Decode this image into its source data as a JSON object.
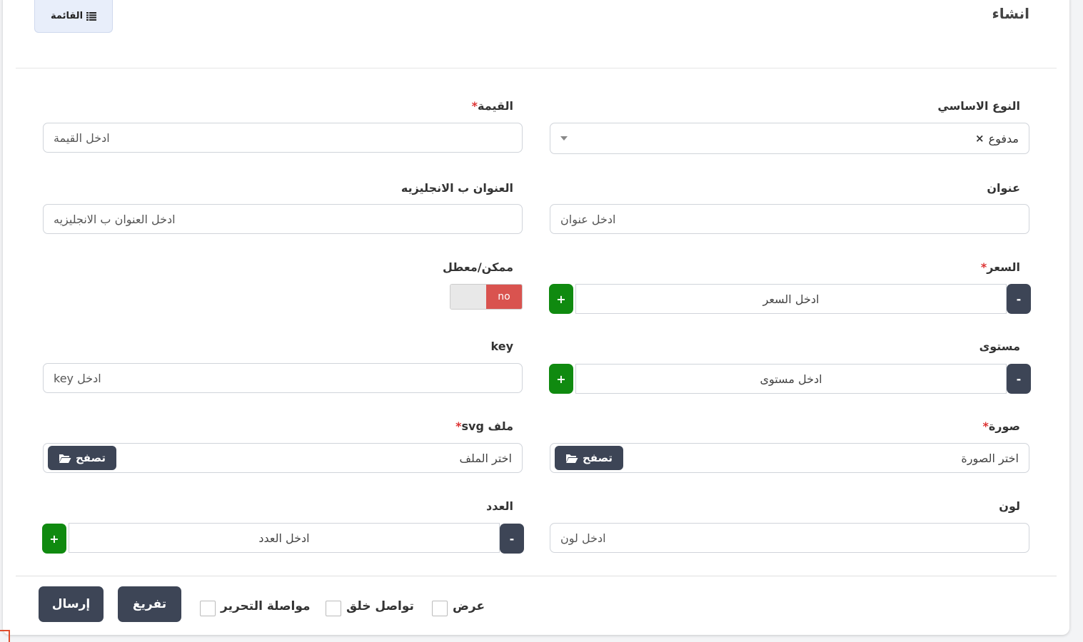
{
  "header": {
    "title": "انشاء",
    "list_button": "القائمة"
  },
  "form": {
    "base_type": {
      "label": "النوع الاساسي",
      "selected": "مدفوع",
      "clear_icon": "×"
    },
    "value": {
      "label": "القيمة",
      "required_mark": "*",
      "placeholder": "ادخل القيمة"
    },
    "title": {
      "label": "عنوان",
      "placeholder": "ادخل عنوان"
    },
    "title_en": {
      "label": "العنوان ب الانجليزيه",
      "placeholder": "ادخل العنوان ب الانجليزيه"
    },
    "price": {
      "label": "السعر",
      "required_mark": "*",
      "placeholder": "ادخل السعر",
      "minus": "-",
      "plus": "+"
    },
    "enabled": {
      "label": "ممكن/معطل",
      "state": "no"
    },
    "level": {
      "label": "مستوى",
      "placeholder": "ادخل مستوى",
      "minus": "-",
      "plus": "+"
    },
    "key": {
      "label": "key",
      "placeholder": "ادخل key"
    },
    "image": {
      "label": "صورة",
      "required_mark": "*",
      "placeholder": "اختر الصورة",
      "browse": "تصفح"
    },
    "svg_file": {
      "label": "ملف svg",
      "required_mark": "*",
      "placeholder": "اختر الملف",
      "browse": "تصفح"
    },
    "color": {
      "label": "لون",
      "placeholder": "ادخل لون"
    },
    "count": {
      "label": "العدد",
      "placeholder": "ادخل العدد",
      "minus": "-",
      "plus": "+"
    }
  },
  "footer": {
    "submit": "إرسال",
    "reset": "تفريغ",
    "continue_editing": "مواصلة التحرير",
    "continue_creating": "تواصل خلق",
    "view": "عرض"
  },
  "colors": {
    "dark_button": "#3d4556",
    "plus_button": "#108a10",
    "toggle_off": "#d9534f",
    "required": "#dd3333"
  }
}
